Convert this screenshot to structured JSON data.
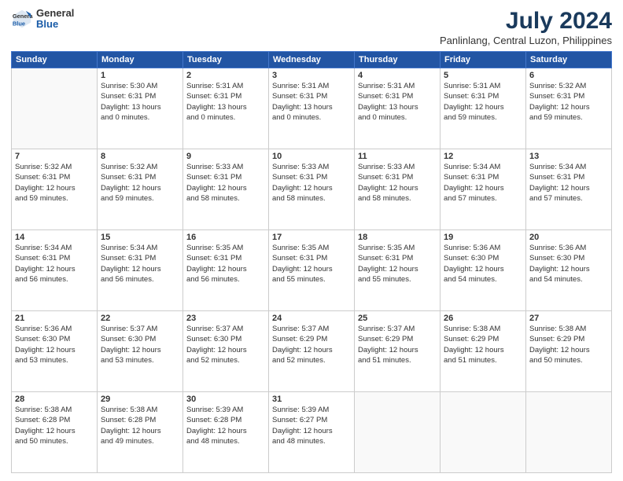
{
  "logo": {
    "general": "General",
    "blue": "Blue"
  },
  "title": "July 2024",
  "subtitle": "Panlinlang, Central Luzon, Philippines",
  "days_header": [
    "Sunday",
    "Monday",
    "Tuesday",
    "Wednesday",
    "Thursday",
    "Friday",
    "Saturday"
  ],
  "weeks": [
    [
      {
        "day": "",
        "info": ""
      },
      {
        "day": "1",
        "info": "Sunrise: 5:30 AM\nSunset: 6:31 PM\nDaylight: 13 hours\nand 0 minutes."
      },
      {
        "day": "2",
        "info": "Sunrise: 5:31 AM\nSunset: 6:31 PM\nDaylight: 13 hours\nand 0 minutes."
      },
      {
        "day": "3",
        "info": "Sunrise: 5:31 AM\nSunset: 6:31 PM\nDaylight: 13 hours\nand 0 minutes."
      },
      {
        "day": "4",
        "info": "Sunrise: 5:31 AM\nSunset: 6:31 PM\nDaylight: 13 hours\nand 0 minutes."
      },
      {
        "day": "5",
        "info": "Sunrise: 5:31 AM\nSunset: 6:31 PM\nDaylight: 12 hours\nand 59 minutes."
      },
      {
        "day": "6",
        "info": "Sunrise: 5:32 AM\nSunset: 6:31 PM\nDaylight: 12 hours\nand 59 minutes."
      }
    ],
    [
      {
        "day": "7",
        "info": "Sunrise: 5:32 AM\nSunset: 6:31 PM\nDaylight: 12 hours\nand 59 minutes."
      },
      {
        "day": "8",
        "info": "Sunrise: 5:32 AM\nSunset: 6:31 PM\nDaylight: 12 hours\nand 59 minutes."
      },
      {
        "day": "9",
        "info": "Sunrise: 5:33 AM\nSunset: 6:31 PM\nDaylight: 12 hours\nand 58 minutes."
      },
      {
        "day": "10",
        "info": "Sunrise: 5:33 AM\nSunset: 6:31 PM\nDaylight: 12 hours\nand 58 minutes."
      },
      {
        "day": "11",
        "info": "Sunrise: 5:33 AM\nSunset: 6:31 PM\nDaylight: 12 hours\nand 58 minutes."
      },
      {
        "day": "12",
        "info": "Sunrise: 5:34 AM\nSunset: 6:31 PM\nDaylight: 12 hours\nand 57 minutes."
      },
      {
        "day": "13",
        "info": "Sunrise: 5:34 AM\nSunset: 6:31 PM\nDaylight: 12 hours\nand 57 minutes."
      }
    ],
    [
      {
        "day": "14",
        "info": "Sunrise: 5:34 AM\nSunset: 6:31 PM\nDaylight: 12 hours\nand 56 minutes."
      },
      {
        "day": "15",
        "info": "Sunrise: 5:34 AM\nSunset: 6:31 PM\nDaylight: 12 hours\nand 56 minutes."
      },
      {
        "day": "16",
        "info": "Sunrise: 5:35 AM\nSunset: 6:31 PM\nDaylight: 12 hours\nand 56 minutes."
      },
      {
        "day": "17",
        "info": "Sunrise: 5:35 AM\nSunset: 6:31 PM\nDaylight: 12 hours\nand 55 minutes."
      },
      {
        "day": "18",
        "info": "Sunrise: 5:35 AM\nSunset: 6:31 PM\nDaylight: 12 hours\nand 55 minutes."
      },
      {
        "day": "19",
        "info": "Sunrise: 5:36 AM\nSunset: 6:30 PM\nDaylight: 12 hours\nand 54 minutes."
      },
      {
        "day": "20",
        "info": "Sunrise: 5:36 AM\nSunset: 6:30 PM\nDaylight: 12 hours\nand 54 minutes."
      }
    ],
    [
      {
        "day": "21",
        "info": "Sunrise: 5:36 AM\nSunset: 6:30 PM\nDaylight: 12 hours\nand 53 minutes."
      },
      {
        "day": "22",
        "info": "Sunrise: 5:37 AM\nSunset: 6:30 PM\nDaylight: 12 hours\nand 53 minutes."
      },
      {
        "day": "23",
        "info": "Sunrise: 5:37 AM\nSunset: 6:30 PM\nDaylight: 12 hours\nand 52 minutes."
      },
      {
        "day": "24",
        "info": "Sunrise: 5:37 AM\nSunset: 6:29 PM\nDaylight: 12 hours\nand 52 minutes."
      },
      {
        "day": "25",
        "info": "Sunrise: 5:37 AM\nSunset: 6:29 PM\nDaylight: 12 hours\nand 51 minutes."
      },
      {
        "day": "26",
        "info": "Sunrise: 5:38 AM\nSunset: 6:29 PM\nDaylight: 12 hours\nand 51 minutes."
      },
      {
        "day": "27",
        "info": "Sunrise: 5:38 AM\nSunset: 6:29 PM\nDaylight: 12 hours\nand 50 minutes."
      }
    ],
    [
      {
        "day": "28",
        "info": "Sunrise: 5:38 AM\nSunset: 6:28 PM\nDaylight: 12 hours\nand 50 minutes."
      },
      {
        "day": "29",
        "info": "Sunrise: 5:38 AM\nSunset: 6:28 PM\nDaylight: 12 hours\nand 49 minutes."
      },
      {
        "day": "30",
        "info": "Sunrise: 5:39 AM\nSunset: 6:28 PM\nDaylight: 12 hours\nand 48 minutes."
      },
      {
        "day": "31",
        "info": "Sunrise: 5:39 AM\nSunset: 6:27 PM\nDaylight: 12 hours\nand 48 minutes."
      },
      {
        "day": "",
        "info": ""
      },
      {
        "day": "",
        "info": ""
      },
      {
        "day": "",
        "info": ""
      }
    ]
  ]
}
